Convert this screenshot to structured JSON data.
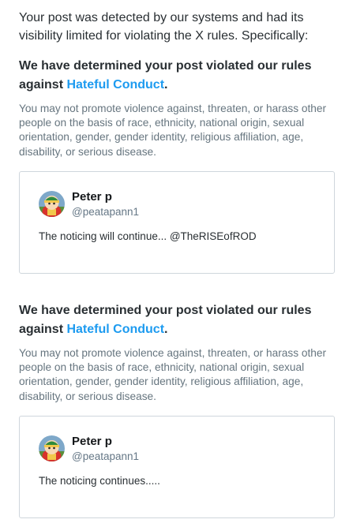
{
  "intro_text": "Your post was detected by our systems and had its visibility limited for violating the X rules. Specifically:",
  "violations": [
    {
      "heading_prefix": "We have determined your post violated our rules against ",
      "rule_link": "Hateful Conduct",
      "heading_suffix": ".",
      "description": "You may not promote violence against, threaten, or harass other people on the basis of race, ethnicity, national origin, sexual orientation, gender, gender identity, religious affiliation, age, disability, or serious disease.",
      "post": {
        "author_name": "Peter p",
        "author_handle": "@peatapann1",
        "text": "The noticing will continue... @TheRISEofROD"
      }
    },
    {
      "heading_prefix": "We have determined your post violated our rules against ",
      "rule_link": "Hateful Conduct",
      "heading_suffix": ".",
      "description": "You may not promote violence against, threaten, or harass other people on the basis of race, ethnicity, national origin, sexual orientation, gender, gender identity, religious affiliation, age, disability, or serious disease.",
      "post": {
        "author_name": "Peter p",
        "author_handle": "@peatapann1",
        "text": "The noticing continues....."
      }
    }
  ],
  "colors": {
    "link": "#1d9bf0",
    "body_text": "#292f33",
    "muted_text": "#66757f",
    "card_border": "#cfd6dc"
  }
}
